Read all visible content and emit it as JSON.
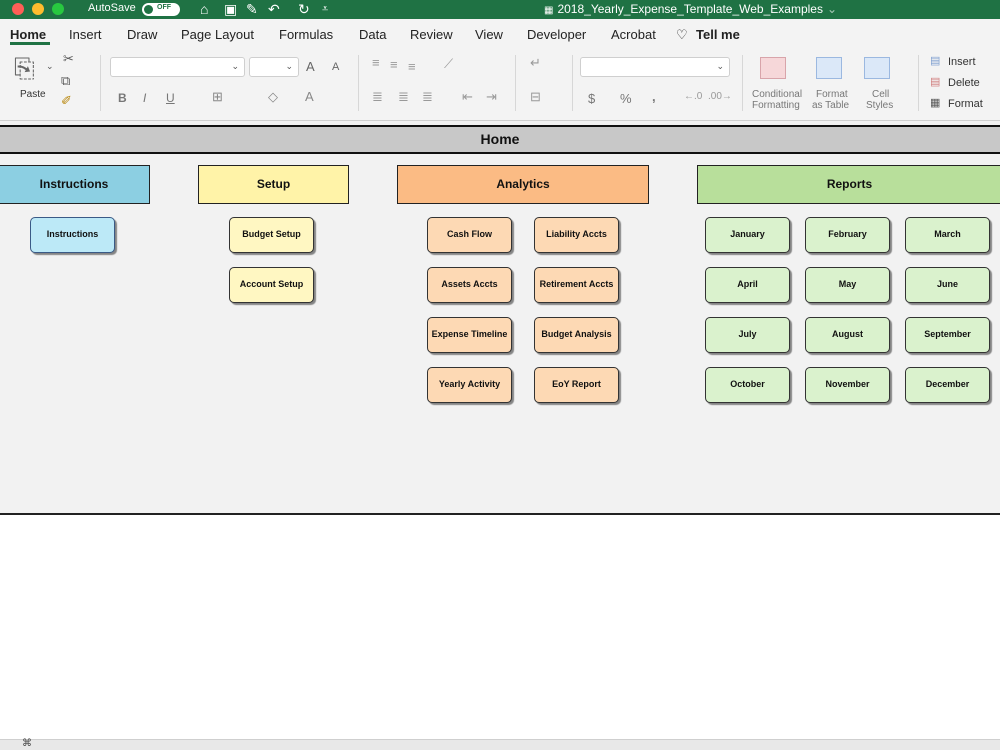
{
  "titlebar": {
    "autosave_label": "AutoSave",
    "autosave_state": "OFF",
    "document_title": "2018_Yearly_Expense_Template_Web_Examples",
    "icons": [
      "home-icon",
      "save-icon",
      "edit-icon",
      "undo-icon",
      "redo-icon",
      "customize-icon"
    ]
  },
  "ribbon": {
    "tabs": [
      "Home",
      "Insert",
      "Draw",
      "Page Layout",
      "Formulas",
      "Data",
      "Review",
      "View",
      "Developer",
      "Acrobat",
      "Tell me"
    ],
    "active_tab": "Home",
    "paste_label": "Paste",
    "conditional_label_1": "Conditional",
    "conditional_label_2": "Formatting",
    "format_table_label_1": "Format",
    "format_table_label_2": "as Table",
    "cell_styles_label_1": "Cell",
    "cell_styles_label_2": "Styles",
    "insert_label": "Insert",
    "delete_label": "Delete",
    "format_label": "Format",
    "bold": "B",
    "italic": "I",
    "underline": "U",
    "font_grow": "A",
    "font_shrink": "A",
    "dollar": "$",
    "percent": "%",
    "comma": ","
  },
  "sheet": {
    "title": "Home",
    "sections": {
      "instructions": "Instructions",
      "setup": "Setup",
      "analytics": "Analytics",
      "reports": "Reports"
    },
    "buttons": {
      "instructions": "Instructions",
      "budget_setup": "Budget Setup",
      "account_setup": "Account Setup",
      "cash_flow": "Cash Flow",
      "liability_accts": "Liability Accts",
      "assets_accts": "Assets Accts",
      "retirement_accts": "Retirement Accts",
      "expense_timeline": "Expense Timeline",
      "budget_analysis": "Budget Analysis",
      "yearly_activity": "Yearly Activity",
      "eoy_report": "EoY Report",
      "january": "January",
      "february": "February",
      "march": "March",
      "april": "April",
      "may": "May",
      "june": "June",
      "july": "July",
      "august": "August",
      "september": "September",
      "october": "October",
      "november": "November",
      "december": "December"
    }
  },
  "colors": {
    "titlebar": "#1f7244",
    "instructions_header": "#8ccfe2",
    "setup_header": "#fff3a8",
    "analytics_header": "#fbbb84",
    "reports_header": "#b8df9b"
  }
}
